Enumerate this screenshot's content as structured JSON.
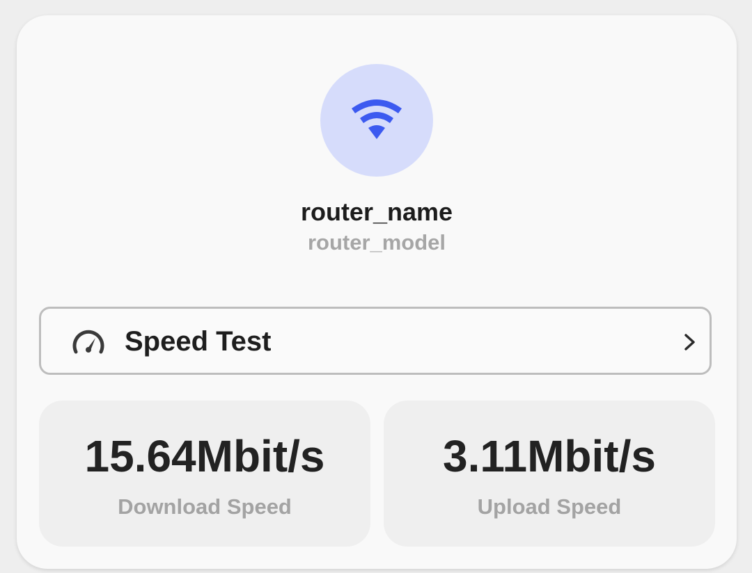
{
  "device": {
    "icon": "wifi-icon",
    "name": "router_name",
    "model": "router_model"
  },
  "speed_test": {
    "icon": "speedometer-icon",
    "label": "Speed Test",
    "chevron_icon": "chevron-right-icon"
  },
  "stats": [
    {
      "value": "15.64Mbit/s",
      "label": "Download Speed"
    },
    {
      "value": "3.11Mbit/s",
      "label": "Upload Speed"
    }
  ],
  "colors": {
    "accent": "#3c5af0",
    "avatar_bg": "#d6dcfb",
    "card_bg": "#f9f9f9",
    "tile_bg": "#efefef"
  }
}
